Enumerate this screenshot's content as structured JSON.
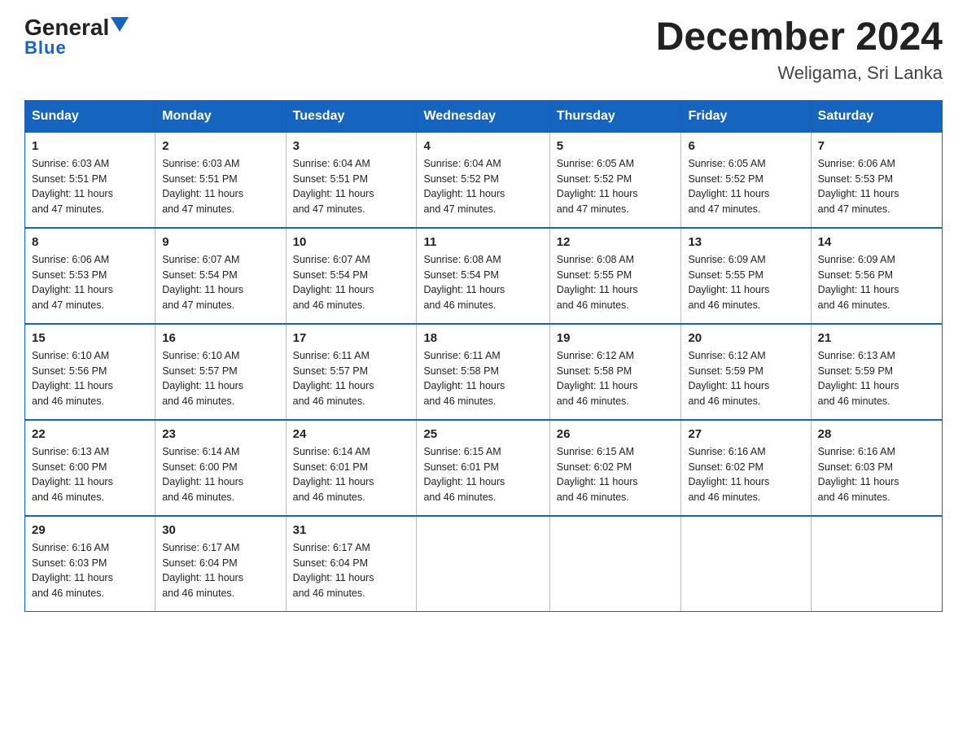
{
  "header": {
    "logo_main": "General",
    "logo_arrow": "▶",
    "logo_blue": "Blue",
    "month_year": "December 2024",
    "location": "Weligama, Sri Lanka"
  },
  "days_of_week": [
    "Sunday",
    "Monday",
    "Tuesday",
    "Wednesday",
    "Thursday",
    "Friday",
    "Saturday"
  ],
  "weeks": [
    [
      {
        "day": "1",
        "sunrise": "6:03 AM",
        "sunset": "5:51 PM",
        "daylight": "11 hours and 47 minutes."
      },
      {
        "day": "2",
        "sunrise": "6:03 AM",
        "sunset": "5:51 PM",
        "daylight": "11 hours and 47 minutes."
      },
      {
        "day": "3",
        "sunrise": "6:04 AM",
        "sunset": "5:51 PM",
        "daylight": "11 hours and 47 minutes."
      },
      {
        "day": "4",
        "sunrise": "6:04 AM",
        "sunset": "5:52 PM",
        "daylight": "11 hours and 47 minutes."
      },
      {
        "day": "5",
        "sunrise": "6:05 AM",
        "sunset": "5:52 PM",
        "daylight": "11 hours and 47 minutes."
      },
      {
        "day": "6",
        "sunrise": "6:05 AM",
        "sunset": "5:52 PM",
        "daylight": "11 hours and 47 minutes."
      },
      {
        "day": "7",
        "sunrise": "6:06 AM",
        "sunset": "5:53 PM",
        "daylight": "11 hours and 47 minutes."
      }
    ],
    [
      {
        "day": "8",
        "sunrise": "6:06 AM",
        "sunset": "5:53 PM",
        "daylight": "11 hours and 47 minutes."
      },
      {
        "day": "9",
        "sunrise": "6:07 AM",
        "sunset": "5:54 PM",
        "daylight": "11 hours and 47 minutes."
      },
      {
        "day": "10",
        "sunrise": "6:07 AM",
        "sunset": "5:54 PM",
        "daylight": "11 hours and 46 minutes."
      },
      {
        "day": "11",
        "sunrise": "6:08 AM",
        "sunset": "5:54 PM",
        "daylight": "11 hours and 46 minutes."
      },
      {
        "day": "12",
        "sunrise": "6:08 AM",
        "sunset": "5:55 PM",
        "daylight": "11 hours and 46 minutes."
      },
      {
        "day": "13",
        "sunrise": "6:09 AM",
        "sunset": "5:55 PM",
        "daylight": "11 hours and 46 minutes."
      },
      {
        "day": "14",
        "sunrise": "6:09 AM",
        "sunset": "5:56 PM",
        "daylight": "11 hours and 46 minutes."
      }
    ],
    [
      {
        "day": "15",
        "sunrise": "6:10 AM",
        "sunset": "5:56 PM",
        "daylight": "11 hours and 46 minutes."
      },
      {
        "day": "16",
        "sunrise": "6:10 AM",
        "sunset": "5:57 PM",
        "daylight": "11 hours and 46 minutes."
      },
      {
        "day": "17",
        "sunrise": "6:11 AM",
        "sunset": "5:57 PM",
        "daylight": "11 hours and 46 minutes."
      },
      {
        "day": "18",
        "sunrise": "6:11 AM",
        "sunset": "5:58 PM",
        "daylight": "11 hours and 46 minutes."
      },
      {
        "day": "19",
        "sunrise": "6:12 AM",
        "sunset": "5:58 PM",
        "daylight": "11 hours and 46 minutes."
      },
      {
        "day": "20",
        "sunrise": "6:12 AM",
        "sunset": "5:59 PM",
        "daylight": "11 hours and 46 minutes."
      },
      {
        "day": "21",
        "sunrise": "6:13 AM",
        "sunset": "5:59 PM",
        "daylight": "11 hours and 46 minutes."
      }
    ],
    [
      {
        "day": "22",
        "sunrise": "6:13 AM",
        "sunset": "6:00 PM",
        "daylight": "11 hours and 46 minutes."
      },
      {
        "day": "23",
        "sunrise": "6:14 AM",
        "sunset": "6:00 PM",
        "daylight": "11 hours and 46 minutes."
      },
      {
        "day": "24",
        "sunrise": "6:14 AM",
        "sunset": "6:01 PM",
        "daylight": "11 hours and 46 minutes."
      },
      {
        "day": "25",
        "sunrise": "6:15 AM",
        "sunset": "6:01 PM",
        "daylight": "11 hours and 46 minutes."
      },
      {
        "day": "26",
        "sunrise": "6:15 AM",
        "sunset": "6:02 PM",
        "daylight": "11 hours and 46 minutes."
      },
      {
        "day": "27",
        "sunrise": "6:16 AM",
        "sunset": "6:02 PM",
        "daylight": "11 hours and 46 minutes."
      },
      {
        "day": "28",
        "sunrise": "6:16 AM",
        "sunset": "6:03 PM",
        "daylight": "11 hours and 46 minutes."
      }
    ],
    [
      {
        "day": "29",
        "sunrise": "6:16 AM",
        "sunset": "6:03 PM",
        "daylight": "11 hours and 46 minutes."
      },
      {
        "day": "30",
        "sunrise": "6:17 AM",
        "sunset": "6:04 PM",
        "daylight": "11 hours and 46 minutes."
      },
      {
        "day": "31",
        "sunrise": "6:17 AM",
        "sunset": "6:04 PM",
        "daylight": "11 hours and 46 minutes."
      },
      null,
      null,
      null,
      null
    ]
  ],
  "labels": {
    "sunrise": "Sunrise:",
    "sunset": "Sunset:",
    "daylight": "Daylight:"
  }
}
